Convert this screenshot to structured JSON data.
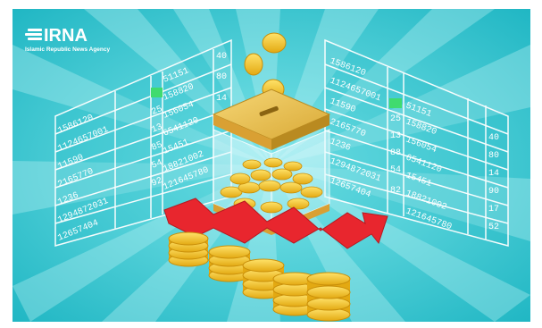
{
  "logo": {
    "brand": "IRNA",
    "tagline": "Islamic Republic News Agency"
  },
  "colors": {
    "background": "#2fc6cf",
    "rays": "#5fd8de",
    "panel_lines": "#ffffff",
    "highlight_cell": "#3fdc6a",
    "arrow": "#e8262e",
    "coin": "#f2c21a",
    "box_lid": "#e0b640"
  },
  "left_panel": {
    "numbers": [
      "1586120",
      "1124657001",
      "11590",
      "2165770",
      "1236",
      "1294872031",
      "12657404"
    ],
    "right_numbers": [
      "51151",
      "158820",
      "156054",
      "6541120",
      "15451",
      "18821002",
      "121645780"
    ],
    "small_numbers": [
      "25",
      "13",
      "85",
      "54",
      "92"
    ],
    "edge_numbers": [
      "40",
      "80",
      "14"
    ]
  },
  "right_panel": {
    "numbers": [
      "1586120",
      "1124657001",
      "11590",
      "2165770",
      "1236",
      "1294872031",
      "12657404"
    ],
    "right_numbers": [
      "51151",
      "158820",
      "156054",
      "6541120",
      "15451",
      "18821002",
      "121645780"
    ],
    "small_numbers": [
      "25",
      "13",
      "88",
      "54",
      "82"
    ],
    "edge_numbers": [
      "40",
      "80",
      "14",
      "90",
      "17",
      "52"
    ]
  }
}
